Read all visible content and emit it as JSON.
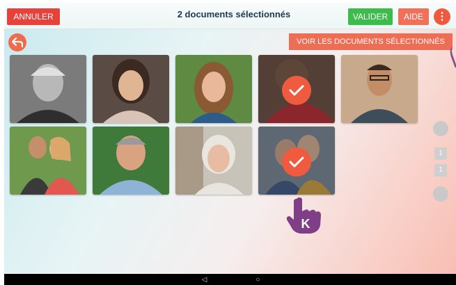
{
  "toolbar": {
    "cancel_label": "ANNULER",
    "title": "2 documents sélectionnés",
    "validate_label": "VALIDER",
    "help_label": "AIDE",
    "more_icon": "⋮"
  },
  "actions": {
    "view_selected_label": "VOIR LES DOCUMENTS SÉLECTIONNÉS"
  },
  "photos": [
    {
      "name": "portrait-old-man-bw",
      "selected": false
    },
    {
      "name": "portrait-woman-smiling",
      "selected": false
    },
    {
      "name": "portrait-woman-outdoors",
      "selected": false
    },
    {
      "name": "portrait-child-red-jacket",
      "selected": true
    },
    {
      "name": "portrait-man-glasses-beard",
      "selected": false
    },
    {
      "name": "portrait-couple",
      "selected": false
    },
    {
      "name": "portrait-man-grey-hair",
      "selected": false
    },
    {
      "name": "portrait-older-woman",
      "selected": false
    },
    {
      "name": "portrait-older-couple",
      "selected": true
    }
  ],
  "pagination": {
    "page_current": "1",
    "page_total": "1"
  },
  "cursor": {
    "hand_letter": "K"
  },
  "android_nav": {
    "back_glyph": "◁",
    "home_glyph": "○"
  },
  "colors": {
    "cancel": "#e6413a",
    "validate": "#3dbb4c",
    "help": "#f0705a",
    "accent": "#ef5b3e",
    "hand": "#7f3f86"
  }
}
